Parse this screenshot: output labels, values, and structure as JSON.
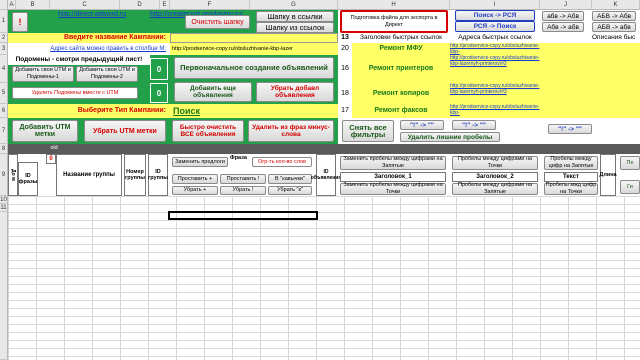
{
  "columns": [
    "A",
    "B",
    "C",
    "D",
    "E",
    "F",
    "G",
    "H",
    "I",
    "J",
    "K",
    "L"
  ],
  "rows": [
    "1",
    "2",
    "3",
    "4",
    "5",
    "6",
    "7",
    "8",
    "9",
    "10",
    "11"
  ],
  "links": {
    "site1": "http://direct-adword.ru",
    "site2": "http://createcont.prodaserv.ru/"
  },
  "top": {
    "excl": "!",
    "clear_header": "Очистить шапку",
    "header_to_links": "Шапку в ссылки",
    "header_from_links": "Шапку из ссылок",
    "prepare_export": "Подготовка файла для экспорта в Директ",
    "search_to_rsya": "Поиск -> РСЯ",
    "rsya_to_search": "РСЯ -> Поиск",
    "kl1": "абв -> Абв",
    "kl2": "АБВ -> Абв",
    "kl3": "Абв -> абв",
    "kl4": "АБВ -> абв"
  },
  "left": {
    "campaign_name": "Введите название Кампании:",
    "ads_hint": "Адрес сайта можно править в столбце М:",
    "subdomains": "Подомены - смотри предыдущий лист!",
    "add_utm_1": "Добавить свои UTM и Подомены-1",
    "add_utm_2": "Добавить свои UTM и Подомены-2",
    "remove_subdomains": "Удалить Подомены вместе с UTM",
    "campaign_type": "Выберите Тип Кампании:",
    "add_utm": "Добавить UTM метки",
    "remove_utm": "Убрать UTM метки"
  },
  "mid": {
    "url_bar": "http://prodservice-copy.ru/obsluzhivanie-kbp-lazer",
    "counter1": "0",
    "counter2": "0",
    "initial_creation": "Первоначальное создание объявлений",
    "add_more": "Добавить еще объявления",
    "remove_added": "Убрать добавл объявления",
    "campaign_type_value": "Поиск",
    "quick_clear": "Быстро очистить ВСЕ объявления",
    "remove_minus": "Удалить из фраз минус-слова",
    "remove_filters": "Снять все фильтры",
    "remove_spaces": "Удалить лишние пробелы",
    "quote_btn1": "\"!\" -> \"\"",
    "quote_btn2": "\"!\" -> \"\"",
    "quote_btn3": "\"!\" -> \"\""
  },
  "quicklinks": {
    "col_num_header": "13",
    "header_label": "Заголовки быстрых ссылок",
    "addr_label": "Адреса быстрых ссылок",
    "desc_label": "Описания быс",
    "rows": [
      {
        "num": "20",
        "title": "Ремонт МФУ",
        "url": "http://prodservice-copy.ru/obsluzhivanie-kbp-"
      },
      {
        "num": "16",
        "title": "Ремонт принтеров",
        "url": "http://prodservice-copy.ru/obsluzhivanie-kbp-lazernyh-printerov/#2"
      },
      {
        "num": "18",
        "title": "Ремонт копиров",
        "url": "http://prodservice-copy.ru/obsluzhivanie-kbp-lazernyh-printerov/#3"
      },
      {
        "num": "17",
        "title": "Ремонт факсов",
        "url": "http://prodservice-copy.ru/obsluzhivanie-kbp-"
      }
    ]
  },
  "table": {
    "col_do": "До м",
    "col_id_phrase": "ID фразы",
    "old": "old",
    "zero": "0",
    "group_name": "Название группы",
    "group_num": "Номер группы",
    "group_id": "ID группы",
    "phrase_btn": "Фраза",
    "replace_before": "Заменить предлоги",
    "count_words": "Огр-ть кол-во слов",
    "put_plus": "Проставить +",
    "put_excl": "Проставить !",
    "in_quotes": "В \"кавычки\"",
    "remove_plus": "Убрать +",
    "remove_excl": "Убрать !",
    "remove_quotes": "Убрать \"к\"",
    "id_ad": "ID объявления",
    "replace_spaces_comma": "Заменить пробелы между цифрами на Запятые",
    "replace_spaces_dot": "Заменить пробелы между цифрами на Точки",
    "title1": "Заголовок_1",
    "title2": "Заголовок_2",
    "text": "Текст",
    "spaces_dot_2": "Пробелы между цифрами на Точки",
    "spaces_comma_2": "Пробелы между цифрами на Запятые",
    "spaces_comma_3": "Пробелы между цифр на Запятые",
    "spaces_dot_3": "Пробелы мжд цифр на Точки",
    "length": "Длина",
    "right_edge_1": "Пе",
    "right_edge_2": "Ги"
  }
}
